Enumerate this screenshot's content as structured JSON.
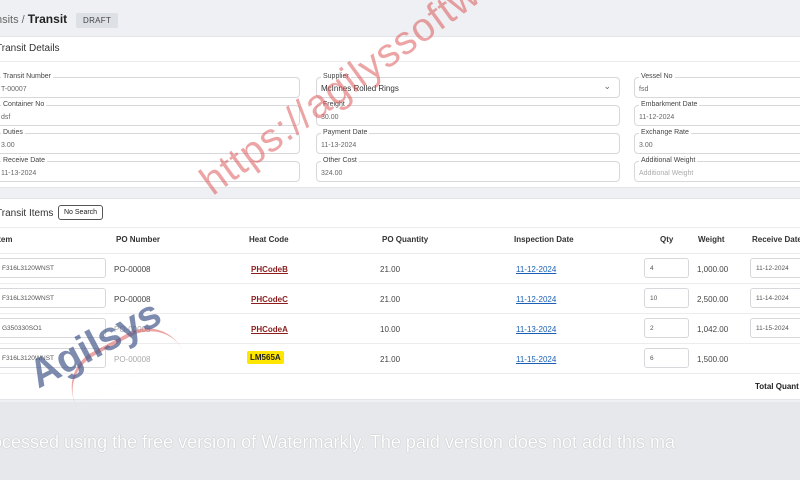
{
  "breadcrumb": {
    "parent": "nsits /",
    "current": "Transit",
    "status": "DRAFT"
  },
  "details": {
    "title": "Transit Details",
    "transit_number": {
      "label": "Transit Number",
      "value": "T-00007"
    },
    "supplier": {
      "label": "Supplier",
      "value": "McInnes Rolled Rings"
    },
    "vessel_no": {
      "label": "Vessel No",
      "value": "fsd"
    },
    "container_no": {
      "label": "Container No",
      "value": "dsf"
    },
    "freight": {
      "label": "Freight",
      "value": "30.00"
    },
    "embarkment_date": {
      "label": "Embarkment Date",
      "value": "11-12-2024"
    },
    "duties": {
      "label": "Duties",
      "value": "3.00"
    },
    "payment_date": {
      "label": "Payment Date",
      "value": "11-13-2024"
    },
    "exchange_rate": {
      "label": "Exchange Rate",
      "value": "3.00"
    },
    "receive_date": {
      "label": "Receive Date",
      "value": "11-13-2024"
    },
    "other_cost": {
      "label": "Other Cost",
      "value": "324.00"
    },
    "additional_weight": {
      "label": "Additional Weight",
      "placeholder": "Additional Weight"
    }
  },
  "items": {
    "title": "Transit Items",
    "no_search": "No Search",
    "headers": {
      "item": "Item",
      "po_number": "PO Number",
      "heat_code": "Heat Code",
      "po_quantity": "PO Quantity",
      "inspection_date": "Inspection Date",
      "qty": "Qty",
      "weight": "Weight",
      "receive_date": "Receive Date"
    },
    "rows": [
      {
        "item": "F316L3120WNST",
        "po": "PO-00008",
        "heat": "PHCodeB",
        "po_qty": "21.00",
        "insp": "11-12-2024",
        "qty": "4",
        "weight": "1,000.00",
        "recv": "11-12-2024"
      },
      {
        "item": "F316L3120WNST",
        "po": "PO-00008",
        "heat": "PHCodeC",
        "po_qty": "21.00",
        "insp": "11-12-2024",
        "qty": "10",
        "weight": "2,500.00",
        "recv": "11-14-2024"
      },
      {
        "item": "G350330SO1",
        "po": "PO-00008",
        "heat": "PHCodeA",
        "po_qty": "10.00",
        "insp": "11-13-2024",
        "qty": "2",
        "weight": "1,042.00",
        "recv": "11-15-2024"
      },
      {
        "item": "F316L3120WNST",
        "po": "PO-00008",
        "heat": "LM565A",
        "po_qty": "21.00",
        "insp": "11-15-2024",
        "qty": "6",
        "weight": "1,500.00",
        "recv": ""
      }
    ],
    "total_label": "Total Quant"
  },
  "watermark": {
    "url": "https://agilyssoftware.com/",
    "logo": "Agilsys",
    "notice": "ocessed using the free version of Watermarkly. The paid version does not add this ma"
  }
}
